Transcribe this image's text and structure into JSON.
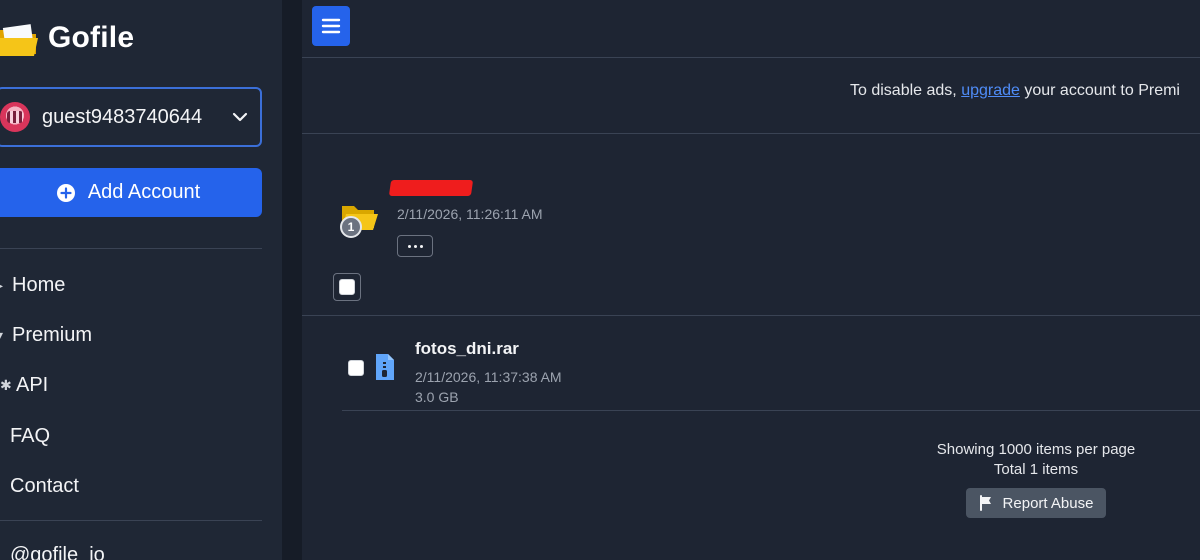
{
  "brand": {
    "name": "Gofile",
    "logo_icon": "folder-logo-icon"
  },
  "account": {
    "username": "guest9483740644",
    "avatar_icon": "avatar"
  },
  "sidebar": {
    "add_account_label": "Add Account",
    "items": [
      {
        "label": "Home",
        "icon": "home-icon"
      },
      {
        "label": "Premium",
        "icon": "premium-icon"
      },
      {
        "label": "API",
        "icon": "api-icon"
      },
      {
        "label": "FAQ",
        "icon": ""
      },
      {
        "label": "Contact",
        "icon": ""
      }
    ],
    "social_handle": "@gofile_io"
  },
  "main": {
    "ads_prefix": "To disable ads, ",
    "ads_link": "upgrade",
    "ads_suffix": " your account to Premi",
    "folder": {
      "date": "2/11/2026, 11:26:11 AM",
      "badge_count": "1",
      "name_redacted": true
    },
    "files": [
      {
        "name": "fotos_dni.rar",
        "date": "2/11/2026, 11:37:38 AM",
        "size": "3.0 GB",
        "icon": "archive-file-icon"
      }
    ],
    "footer": {
      "per_page": "Showing 1000 items per page",
      "total": "Total 1 items"
    },
    "report_label": "Report Abuse"
  },
  "colors": {
    "background": "#1e2533",
    "sidebar": "#1f2735",
    "accent": "#2563eb",
    "link": "#4f8cf7",
    "folder": "#f5c518",
    "file_icon": "#60a5fa",
    "redaction": "#ef1d1d"
  }
}
